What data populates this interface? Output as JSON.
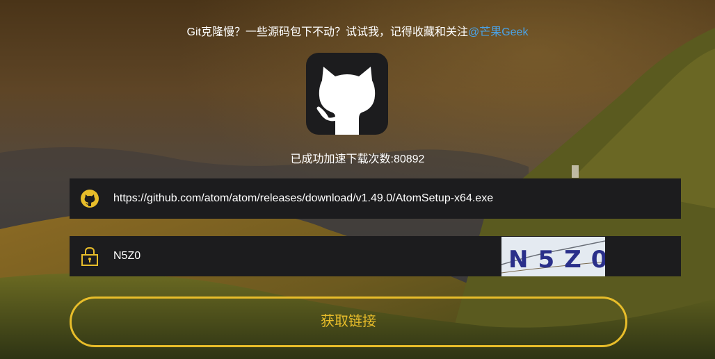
{
  "header": {
    "notice": "Git克隆慢？一些源码包下不动？试试我，记得收藏和关注",
    "author_link": "@芒果Geek"
  },
  "logo": {
    "icon": "github-octocat-icon"
  },
  "stats": {
    "count_text": "已成功加速下载次数:80892"
  },
  "url_field": {
    "icon": "github-icon",
    "value": "https://github.com/atom/atom/releases/download/v1.49.0/AtomSetup-x64.exe"
  },
  "captcha_field": {
    "icon": "lock-icon",
    "value": "N5Z0",
    "captcha_text": "N5Z0"
  },
  "submit": {
    "label": "获取链接"
  },
  "colors": {
    "accent": "#e8bd2a",
    "link": "#4aa3e8",
    "panel": "#1c1c1e"
  }
}
